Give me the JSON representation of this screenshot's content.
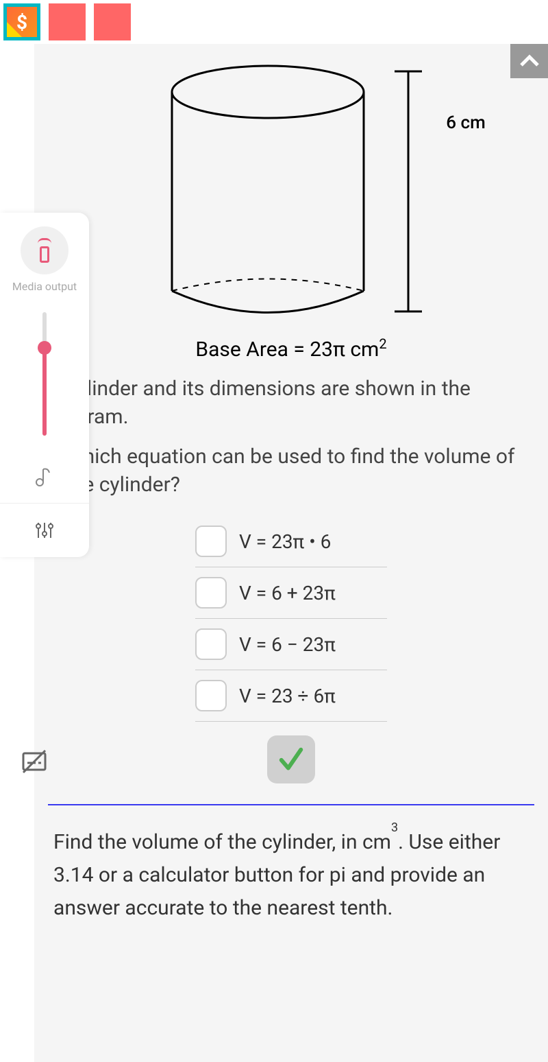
{
  "topbar": {
    "dollar_symbol": "$"
  },
  "sidepanel": {
    "media_label": "Media output"
  },
  "diagram": {
    "height_label": "6 cm",
    "base_area_html": "Base Area = 23π cm",
    "base_area_exp": "2"
  },
  "problem": {
    "intro": "A cylinder and its dimensions are shown in the diagram.",
    "question": "Which equation can be used to find the volume of the cylinder?",
    "options": [
      "V = 23π • 6",
      "V = 6 + 23π",
      "V = 6 − 23π",
      "V = 23 ÷ 6π"
    ],
    "followup_pre": "Find the volume of the cylinder, in cm",
    "followup_exp": "3",
    "followup_post": ". Use either 3.14 or a calculator button for pi and provide an answer accurate to the nearest tenth."
  },
  "chart_data": {
    "type": "diagram",
    "shape": "cylinder",
    "height_cm": 6,
    "base_area_cm2": "23π"
  }
}
